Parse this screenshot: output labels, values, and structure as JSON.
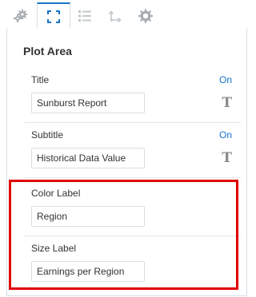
{
  "tabs": [
    {
      "name": "settings-tab",
      "icon": "gears-icon",
      "active": false
    },
    {
      "name": "plot-area-tab",
      "icon": "plot-area-icon",
      "active": true
    },
    {
      "name": "list-tab",
      "icon": "list-icon",
      "active": false
    },
    {
      "name": "axis-tab",
      "icon": "axis-arrows-icon",
      "active": false
    },
    {
      "name": "chart-style-tab",
      "icon": "gear-circle-icon",
      "active": false
    }
  ],
  "panel": {
    "title": "Plot Area",
    "title_row": {
      "label": "Title",
      "state": "On",
      "value": "Sunburst Report",
      "font_icon": "T"
    },
    "subtitle_row": {
      "label": "Subtitle",
      "state": "On",
      "value": "Historical Data Value",
      "font_icon": "T"
    },
    "color_label": {
      "label": "Color Label",
      "value": "Region"
    },
    "size_label": {
      "label": "Size Label",
      "value": "Earnings per Region"
    }
  },
  "colors": {
    "accent": "#1874c9",
    "highlight": "#e00000",
    "icon_grey": "#a8adb2"
  }
}
